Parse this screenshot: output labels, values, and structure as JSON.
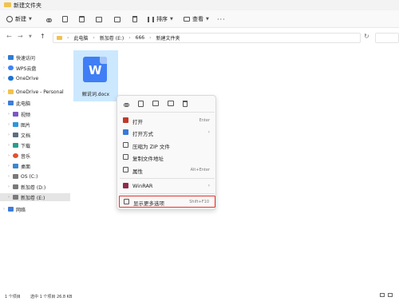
{
  "window": {
    "title": "新建文件夹"
  },
  "toolbar": {
    "new_label": "新建",
    "sort_label": "排序",
    "view_label": "查看"
  },
  "address": {
    "crumbs": [
      "此电脑",
      "新加卷 (E:)",
      "666",
      "新建文件夹"
    ]
  },
  "sidebar": {
    "items": [
      {
        "label": "快速访问",
        "icon": "star-icon",
        "color": "#2f7bd6"
      },
      {
        "label": "WPS云盘",
        "icon": "cloud-icon",
        "color": "#3f83f8"
      },
      {
        "label": "OneDrive",
        "icon": "cloud-icon",
        "color": "#1b73d3"
      },
      {
        "label": "OneDrive - Personal",
        "icon": "folder-icon",
        "color": "#f2c24e"
      },
      {
        "label": "此电脑",
        "icon": "pc-icon",
        "color": "#3d7dd8"
      },
      {
        "label": "视频",
        "icon": "video-icon",
        "color": "#7e57c2"
      },
      {
        "label": "图片",
        "icon": "picture-icon",
        "color": "#2f95d8"
      },
      {
        "label": "文档",
        "icon": "document-icon",
        "color": "#5b6d85"
      },
      {
        "label": "下载",
        "icon": "download-icon",
        "color": "#2a9d8f"
      },
      {
        "label": "音乐",
        "icon": "music-icon",
        "color": "#e0522e"
      },
      {
        "label": "桌面",
        "icon": "desktop-icon",
        "color": "#3a86d1"
      },
      {
        "label": "OS (C:)",
        "icon": "drive-icon",
        "color": "#7a7a7a"
      },
      {
        "label": "新加卷 (D:)",
        "icon": "drive-icon",
        "color": "#7a7a7a"
      },
      {
        "label": "新加卷 (E:)",
        "icon": "drive-icon",
        "color": "#7a7a7a"
      },
      {
        "label": "网络",
        "icon": "network-icon",
        "color": "#3d7dd8"
      }
    ]
  },
  "file": {
    "name": "解说词.docx",
    "badge": "W"
  },
  "context_menu": {
    "items": [
      {
        "label": "打开",
        "hint": "Enter",
        "icon": "open-icon",
        "color": "#c0392b"
      },
      {
        "label": "打开方式",
        "hint": "",
        "icon": "open-with-icon",
        "color": "#3a78d8"
      },
      {
        "label": "压缩为 ZIP 文件",
        "hint": "",
        "icon": "zip-icon",
        "color": "#555555"
      },
      {
        "label": "复制文件地址",
        "hint": "",
        "icon": "copy-path-icon",
        "color": "#555555"
      },
      {
        "label": "属性",
        "hint": "Alt+Enter",
        "icon": "properties-icon",
        "color": "#555555"
      },
      {
        "label": "WinRAR",
        "hint": "",
        "icon": "winrar-icon",
        "color": "#8e2b4f"
      },
      {
        "label": "显示更多选项",
        "hint": "Shift+F10",
        "icon": "more-options-icon",
        "color": "#555555"
      }
    ],
    "highlight_color": "#e0322e"
  },
  "status": {
    "count": "1 个项目",
    "selected": "选中 1 个项目  26.8 KB"
  },
  "colors": {
    "selection": "#cce8ff",
    "accent": "#3f7ef5",
    "folder": "#f2c24e"
  }
}
